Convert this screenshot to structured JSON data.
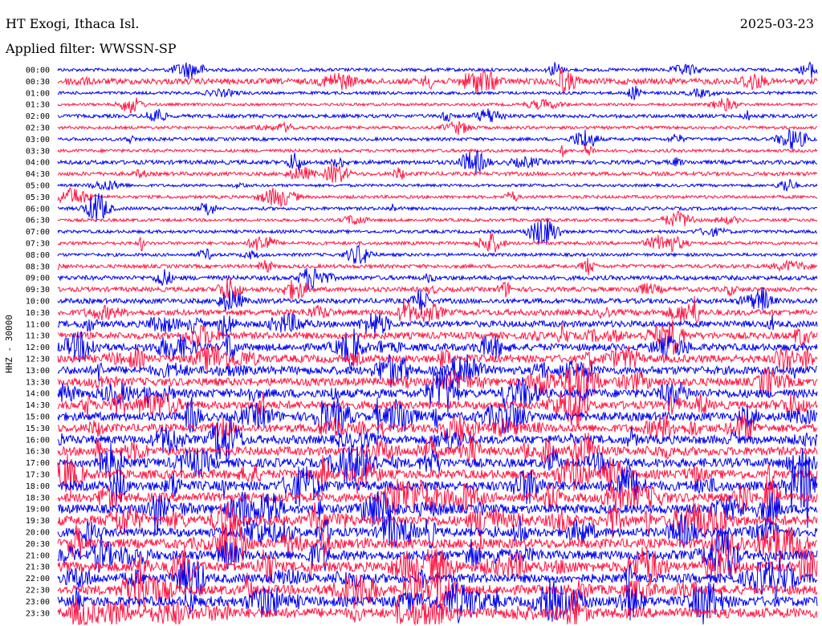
{
  "header": {
    "station": "HT Exogi, Ithaca Isl.",
    "filter": "Applied filter: WWSSN-SP",
    "date": "2025-03-23",
    "channel": "HHZ - 30000"
  },
  "colors": {
    "even_trace": "#0000ee",
    "odd_trace": "#ff1744"
  },
  "chart_data": {
    "type": "line",
    "title": "HT Exogi, Ithaca Isl.",
    "subtitle": "Applied filter: WWSSN-SP",
    "ylabel": "HHZ - 30000",
    "xlabel": "",
    "grid": false,
    "y_tick_labels": [
      "00:00",
      "00:30",
      "01:00",
      "01:30",
      "02:00",
      "02:30",
      "03:00",
      "03:30",
      "04:00",
      "04:30",
      "05:00",
      "05:30",
      "06:00",
      "06:30",
      "07:00",
      "07:30",
      "08:00",
      "08:30",
      "09:00",
      "09:30",
      "10:00",
      "10:30",
      "11:00",
      "11:30",
      "12:00",
      "12:30",
      "13:00",
      "13:30",
      "14:00",
      "14:30",
      "15:00",
      "15:30",
      "16:00",
      "16:30",
      "17:00",
      "17:30",
      "18:00",
      "18:30",
      "19:00",
      "19:30",
      "20:00",
      "20:30",
      "21:00",
      "21:30",
      "22:00",
      "22:30",
      "23:00",
      "23:30"
    ],
    "series_colors": [
      "#0000ee",
      "#ff1744"
    ],
    "trace_activity": [
      0.15,
      0.45,
      0.12,
      0.1,
      0.18,
      0.12,
      0.15,
      0.14,
      0.25,
      0.22,
      0.1,
      0.14,
      0.16,
      0.12,
      0.14,
      0.16,
      0.14,
      0.2,
      0.28,
      0.3,
      0.35,
      0.45,
      0.5,
      0.55,
      0.6,
      0.65,
      0.7,
      0.7,
      0.75,
      0.7,
      0.75,
      0.7,
      0.75,
      0.75,
      0.8,
      0.8,
      0.85,
      0.85,
      0.8,
      0.9,
      0.8,
      0.85,
      0.85,
      0.9,
      0.8,
      0.85,
      0.9,
      0.9
    ]
  }
}
